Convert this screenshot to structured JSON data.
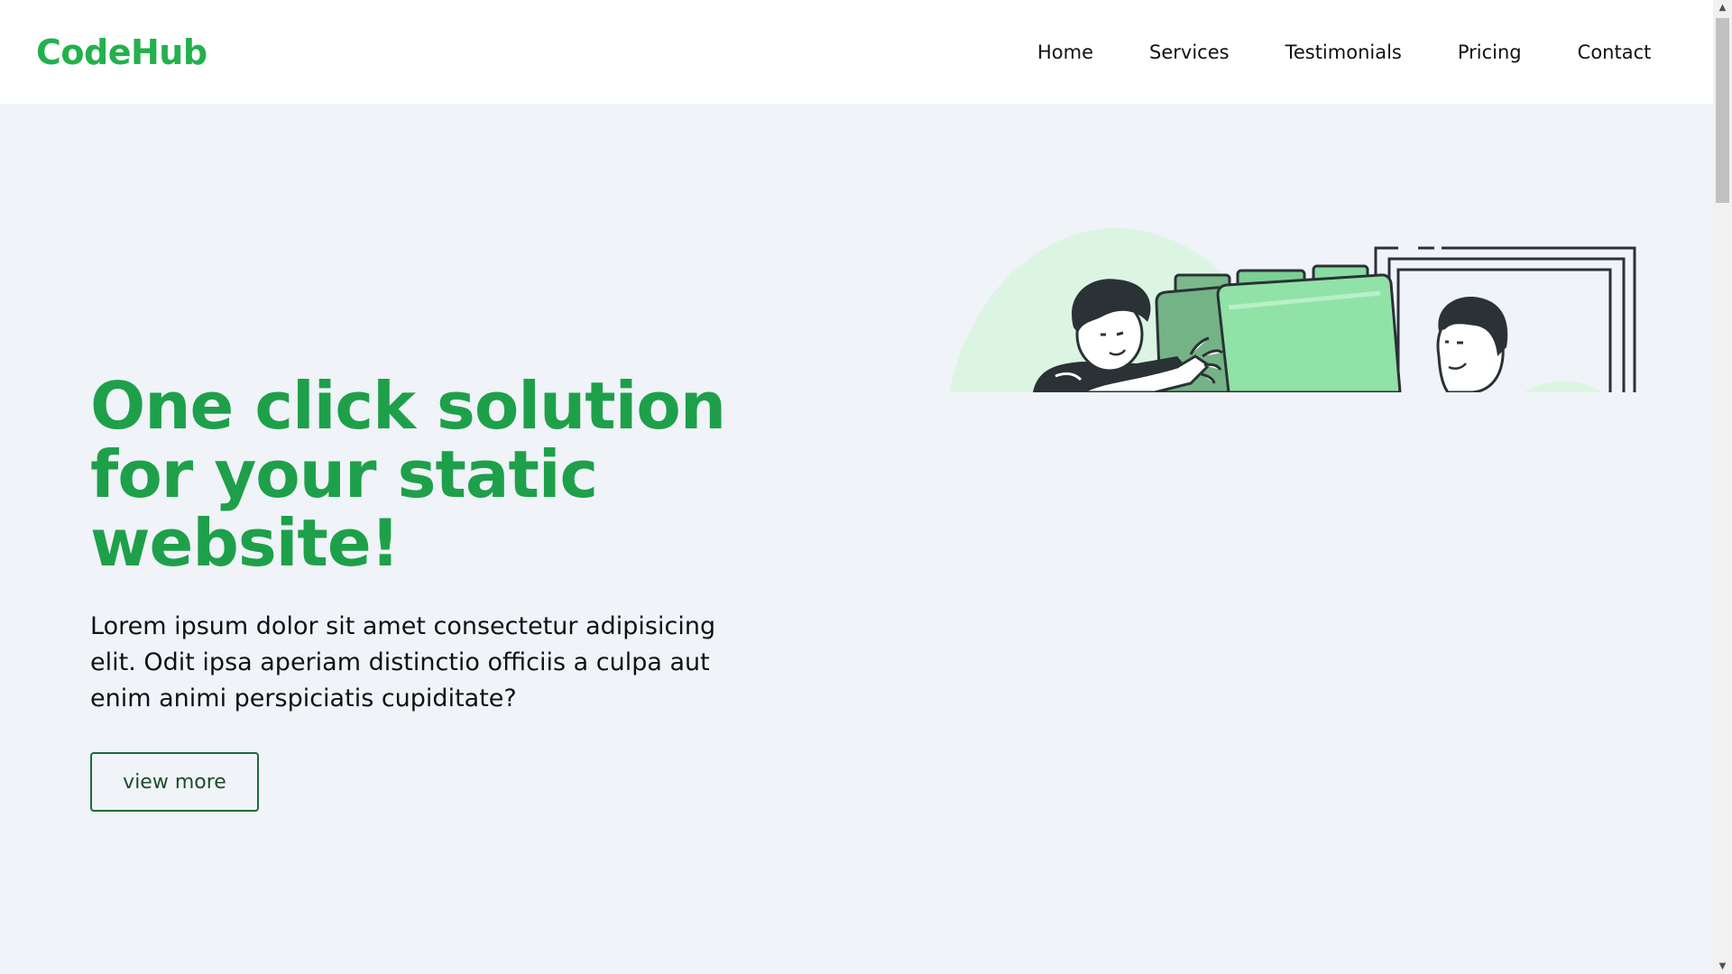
{
  "header": {
    "brand": "CodeHub",
    "nav": [
      {
        "label": "Home"
      },
      {
        "label": "Services"
      },
      {
        "label": "Testimonials"
      },
      {
        "label": "Pricing"
      },
      {
        "label": "Contact"
      }
    ]
  },
  "hero": {
    "title": "One click solution for your static website!",
    "text": "Lorem ipsum dolor sit amet consectetur adipisicing elit. Odit ipsa aperiam distinctio officiis a culpa aut enim animi perspiciatis cupiditate?",
    "cta": "view more"
  },
  "colors": {
    "brand_green": "#22b14c",
    "title_green": "#1ea04a",
    "button_border": "#1a6b3a",
    "hero_bg": "#f0f3f8",
    "header_bg": "#ffffff"
  },
  "icons": {
    "illustration": "hero-illustration",
    "scroll_up": "scroll-up-icon",
    "scroll_down": "scroll-down-icon"
  }
}
